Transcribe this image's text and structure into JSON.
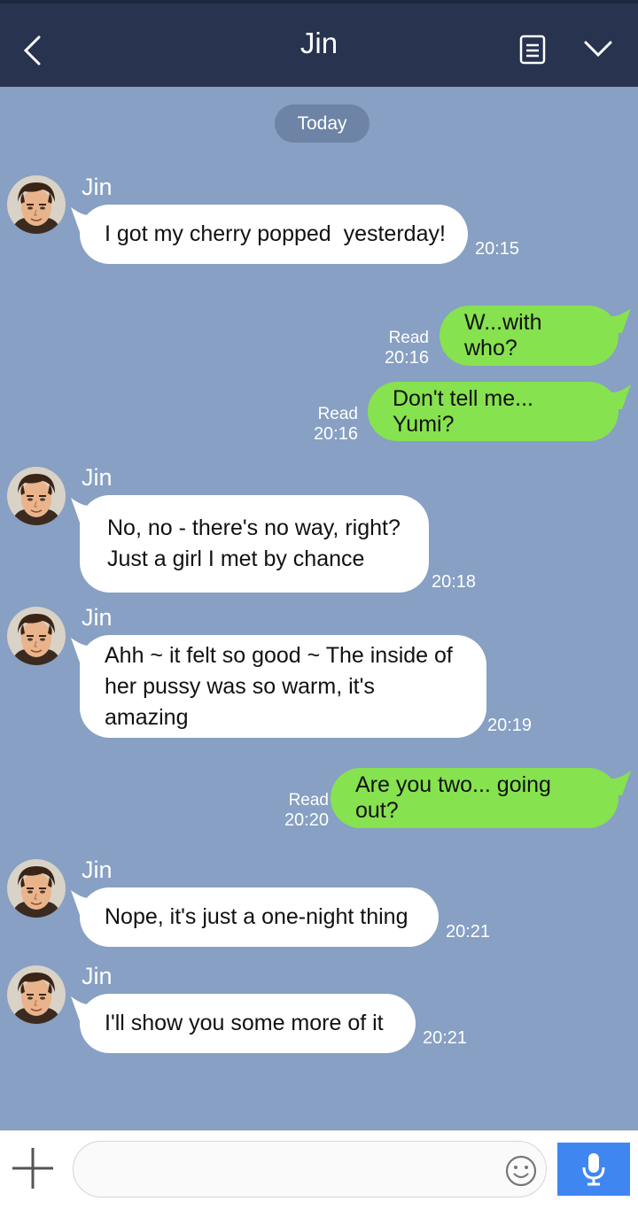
{
  "header": {
    "title": "Jin",
    "back_icon": "chevron-left-icon",
    "memo_icon": "document-icon",
    "menu_icon": "chevron-down-icon"
  },
  "date_divider": "Today",
  "contact_name": "Jin",
  "read_label": "Read",
  "messages": [
    {
      "from": "Jin",
      "text": "I got my cherry popped  yesterday!",
      "time": "20:15"
    },
    {
      "from": "me",
      "text": "W...with who?",
      "time": "20:16",
      "status": "Read"
    },
    {
      "from": "me",
      "text": "Don't tell me... Yumi?",
      "time": "20:16",
      "status": "Read"
    },
    {
      "from": "Jin",
      "lines": [
        "No, no - there's no way, right?",
        "Just a girl I met by chance"
      ],
      "time": "20:18"
    },
    {
      "from": "Jin",
      "lines": [
        "Ahh ~ it felt so good ~ The inside of",
        "her pussy was so warm, it's amazing"
      ],
      "time": "20:19"
    },
    {
      "from": "me",
      "text": "Are you two... going out?",
      "time": "20:20",
      "status": "Read"
    },
    {
      "from": "Jin",
      "text": "Nope, it's just a one-night thing",
      "time": "20:21"
    },
    {
      "from": "Jin",
      "text": "I'll show you some more of it",
      "time": "20:21"
    }
  ],
  "input": {
    "placeholder": "",
    "value": ""
  },
  "colors": {
    "header": "#283350",
    "background": "#87a0c3",
    "outgoing": "#86e24f",
    "incoming": "#ffffff",
    "mic_button": "#3f86f1"
  }
}
